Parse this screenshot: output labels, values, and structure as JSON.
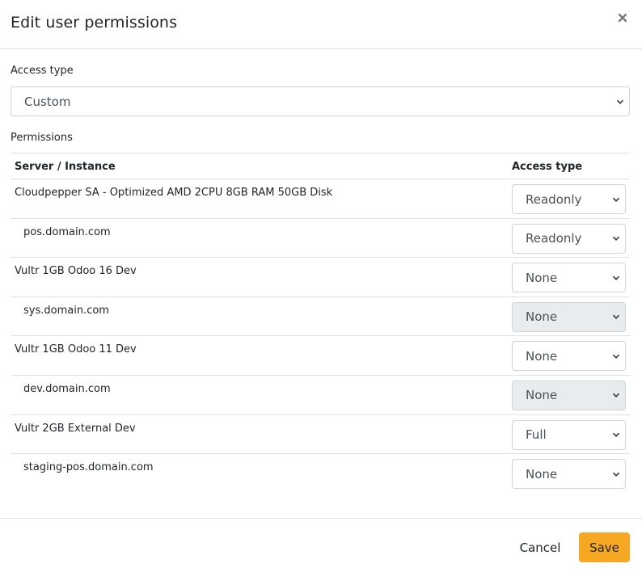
{
  "modal": {
    "title": "Edit user permissions"
  },
  "access_type": {
    "label": "Access type",
    "value": "Custom"
  },
  "permissions": {
    "label": "Permissions",
    "columns": [
      "Server / Instance",
      "Access type"
    ],
    "rows": [
      {
        "name": "Cloudpepper SA - Optimized AMD 2CPU 8GB RAM 50GB Disk",
        "level": "server",
        "access": "Readonly",
        "disabled": false
      },
      {
        "name": "pos.domain.com",
        "level": "instance",
        "access": "Readonly",
        "disabled": false
      },
      {
        "name": "Vultr 1GB Odoo 16 Dev",
        "level": "server",
        "access": "None",
        "disabled": false
      },
      {
        "name": "sys.domain.com",
        "level": "instance",
        "access": "None",
        "disabled": true
      },
      {
        "name": "Vultr 1GB Odoo 11 Dev",
        "level": "server",
        "access": "None",
        "disabled": false
      },
      {
        "name": "dev.domain.com",
        "level": "instance",
        "access": "None",
        "disabled": true
      },
      {
        "name": "Vultr 2GB External Dev",
        "level": "server",
        "access": "Full",
        "disabled": false
      },
      {
        "name": "staging-pos.domain.com",
        "level": "instance",
        "access": "None",
        "disabled": false
      }
    ]
  },
  "footer": {
    "cancel_label": "Cancel",
    "save_label": "Save"
  },
  "icons": {
    "close": "close-icon",
    "select_arrow": "chevron-down-icon"
  },
  "colors": {
    "save_button": "#f7a823",
    "disabled_select": "#e9ecef",
    "border": "#dee2e6"
  }
}
